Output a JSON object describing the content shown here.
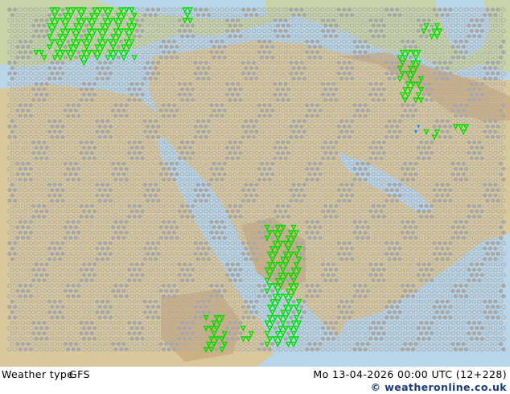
{
  "footer": {
    "title": "Weather type",
    "model": "GFS",
    "valid_time": "Mo 13-04-2026 00:00 UTC (12+228)",
    "credit": "© weatheronline.co.uk"
  },
  "colors": {
    "sea": "#b8d6ea",
    "land_low": "#c6d4a8",
    "desert": "#d9c89b",
    "mountain": "#c9ab7e",
    "cloud_symbol": "#a8a8a8",
    "shower": "#00d800",
    "snow_shower": "#2f8cff"
  },
  "legend_icons": [
    "cloud-symbol",
    "shower-symbol",
    "snow-shower-symbol"
  ]
}
